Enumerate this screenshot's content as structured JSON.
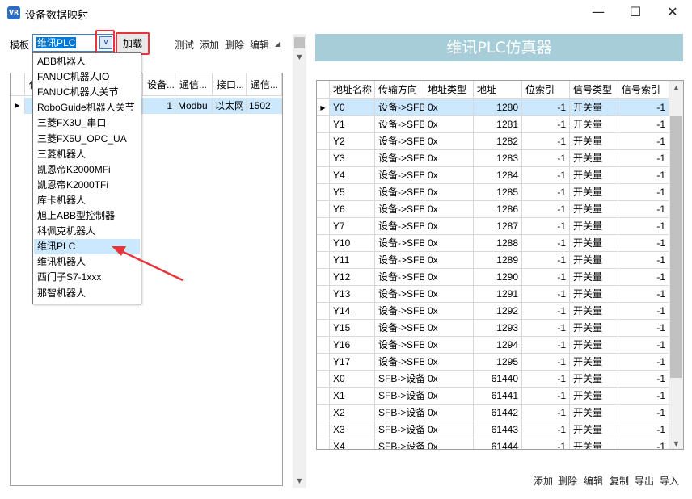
{
  "window": {
    "icon_text": "VR",
    "title": "设备数据映射",
    "minimize": "—",
    "maximize": "☐",
    "close": "✕"
  },
  "toolbar": {
    "template_label": "模板",
    "template_value": "维讯PLC",
    "load": "加载",
    "test": "测试",
    "add": "添加",
    "delete": "删除",
    "edit": "编辑"
  },
  "template_options": [
    "ABB机器人",
    "FANUC机器人IO",
    "FANUC机器人关节",
    "RoboGuide机器人关节",
    "三菱FX3U_串口",
    "三菱FX5U_OPC_UA",
    "三菱机器人",
    "凯恩帝K2000MFi",
    "凯恩帝K2000TFi",
    "库卡机器人",
    "旭上ABB型控制器",
    "科佩克机器人",
    "维讯PLC",
    "维讯机器人",
    "西门子S7-1xxx",
    "那智机器人"
  ],
  "selected_option": "维讯PLC",
  "left_grid": {
    "headers": [
      "设备...",
      "通信...",
      "接口...",
      "通信..."
    ],
    "hidden_header": "传",
    "row": [
      "1",
      "Modbu",
      "以太网",
      "1502"
    ]
  },
  "simulator": {
    "title": "维讯PLC仿真器",
    "headers": [
      "地址名称",
      "传输方向",
      "地址类型",
      "地址",
      "位索引",
      "信号类型",
      "信号索引"
    ],
    "rows": [
      [
        "Y0",
        "设备->SFB",
        "0x",
        "1280",
        "-1",
        "开关量",
        "-1"
      ],
      [
        "Y1",
        "设备->SFB",
        "0x",
        "1281",
        "-1",
        "开关量",
        "-1"
      ],
      [
        "Y2",
        "设备->SFB",
        "0x",
        "1282",
        "-1",
        "开关量",
        "-1"
      ],
      [
        "Y3",
        "设备->SFB",
        "0x",
        "1283",
        "-1",
        "开关量",
        "-1"
      ],
      [
        "Y4",
        "设备->SFB",
        "0x",
        "1284",
        "-1",
        "开关量",
        "-1"
      ],
      [
        "Y5",
        "设备->SFB",
        "0x",
        "1285",
        "-1",
        "开关量",
        "-1"
      ],
      [
        "Y6",
        "设备->SFB",
        "0x",
        "1286",
        "-1",
        "开关量",
        "-1"
      ],
      [
        "Y7",
        "设备->SFB",
        "0x",
        "1287",
        "-1",
        "开关量",
        "-1"
      ],
      [
        "Y10",
        "设备->SFB",
        "0x",
        "1288",
        "-1",
        "开关量",
        "-1"
      ],
      [
        "Y11",
        "设备->SFB",
        "0x",
        "1289",
        "-1",
        "开关量",
        "-1"
      ],
      [
        "Y12",
        "设备->SFB",
        "0x",
        "1290",
        "-1",
        "开关量",
        "-1"
      ],
      [
        "Y13",
        "设备->SFB",
        "0x",
        "1291",
        "-1",
        "开关量",
        "-1"
      ],
      [
        "Y14",
        "设备->SFB",
        "0x",
        "1292",
        "-1",
        "开关量",
        "-1"
      ],
      [
        "Y15",
        "设备->SFB",
        "0x",
        "1293",
        "-1",
        "开关量",
        "-1"
      ],
      [
        "Y16",
        "设备->SFB",
        "0x",
        "1294",
        "-1",
        "开关量",
        "-1"
      ],
      [
        "Y17",
        "设备->SFB",
        "0x",
        "1295",
        "-1",
        "开关量",
        "-1"
      ],
      [
        "X0",
        "SFB->设备",
        "0x",
        "61440",
        "-1",
        "开关量",
        "-1"
      ],
      [
        "X1",
        "SFB->设备",
        "0x",
        "61441",
        "-1",
        "开关量",
        "-1"
      ],
      [
        "X2",
        "SFB->设备",
        "0x",
        "61442",
        "-1",
        "开关量",
        "-1"
      ],
      [
        "X3",
        "SFB->设备",
        "0x",
        "61443",
        "-1",
        "开关量",
        "-1"
      ],
      [
        "X4",
        "SFB->设备",
        "0x",
        "61444",
        "-1",
        "开关量",
        "-1"
      ]
    ]
  },
  "bottom_toolbar": {
    "add": "添加",
    "delete": "删除",
    "edit": "编辑",
    "copy": "复制",
    "export": "导出",
    "import": "导入"
  },
  "colors": {
    "accent": "#0078d7",
    "selection": "#cce8ff",
    "highlight_box": "#e8343a",
    "sim_header": "#a7ced8"
  }
}
